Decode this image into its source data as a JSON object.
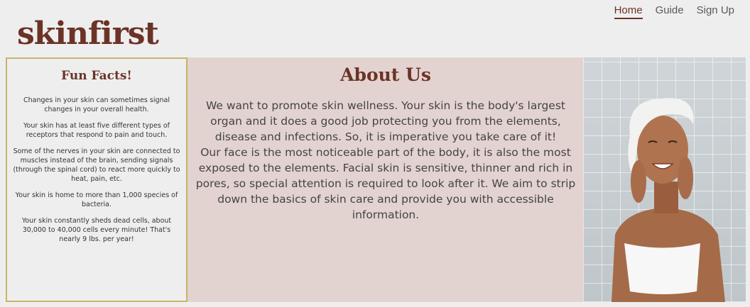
{
  "brand": {
    "logo_text": "skinfirst"
  },
  "nav": {
    "items": [
      {
        "label": "Home",
        "active": true
      },
      {
        "label": "Guide",
        "active": false
      },
      {
        "label": "Sign Up",
        "active": false
      }
    ]
  },
  "fun_facts": {
    "title": "Fun Facts!",
    "facts": [
      "Changes in your skin can sometimes signal changes in your overall health.",
      "Your skin has at least five different types of receptors that respond to pain and touch.",
      "Some of the nerves in your skin are connected to muscles instead of the brain, sending signals (through the spinal cord) to react more quickly to heat, pain, etc.",
      "Your skin is home to more than 1,000 species of bacteria.",
      "Your skin constantly sheds dead cells, about 30,000 to 40,000 cells every minute! That's nearly 9 lbs. per year!"
    ]
  },
  "about": {
    "title": "About Us",
    "paragraphs": [
      "We want to promote skin wellness. Your skin is the body's largest organ and it does a good job protecting you from the elements, disease and infections. So, it is imperative you take care of it!",
      "Our face is the most noticeable part of the body, it is also the most exposed to the elements. Facial skin is sensitive, thinner and rich in pores, so special attention is required to look after it. We aim to strip down the basics of skin care and provide you with accessible information."
    ]
  },
  "colors": {
    "brand": "#6b3326",
    "content_bg": "#e3d3d0",
    "facts_border": "#c8b46a"
  },
  "hero_image": {
    "icon": "woman-with-towel-photo"
  }
}
